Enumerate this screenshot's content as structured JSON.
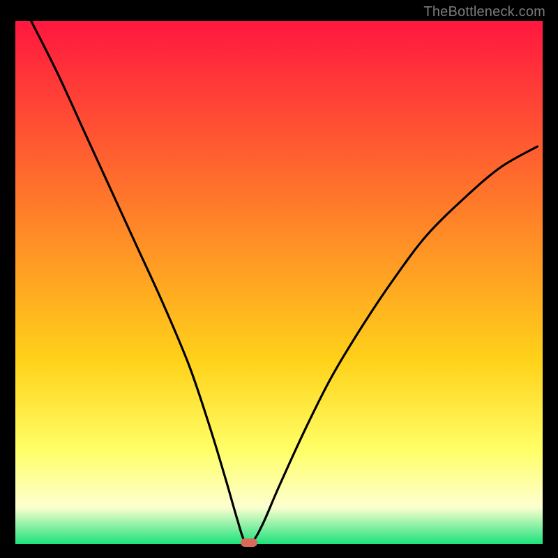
{
  "watermark": "TheBottleneck.com",
  "colors": {
    "top": "#ff173f",
    "mid1": "#ff7a2a",
    "mid2": "#ffd21a",
    "mid3": "#ffff66",
    "mid4": "#fdffd0",
    "bottom": "#1be27a",
    "curve": "#000000",
    "frame": "#000000",
    "marker": "#d96a5a"
  },
  "chart_data": {
    "type": "line",
    "title": "",
    "xlabel": "",
    "ylabel": "",
    "xlim": [
      0,
      100
    ],
    "ylim": [
      0,
      100
    ],
    "series": [
      {
        "name": "bottleneck-curve",
        "x": [
          3,
          8,
          13,
          18,
          23,
          28,
          33,
          37,
          40,
          42,
          43.5,
          45,
          47,
          50,
          55,
          60,
          66,
          72,
          78,
          85,
          92,
          99
        ],
        "values": [
          100,
          90,
          79,
          68,
          57,
          46,
          34,
          22,
          12,
          5,
          0.5,
          0.5,
          4,
          11,
          22,
          32,
          42,
          51,
          59,
          66,
          72,
          76
        ]
      }
    ],
    "marker": {
      "x": 44.3,
      "y": 0.3
    },
    "gradient_stops": [
      {
        "offset": 0,
        "value": 100,
        "color": "#ff173f"
      },
      {
        "offset": 35,
        "value": 65,
        "color": "#ff7a2a"
      },
      {
        "offset": 65,
        "value": 35,
        "color": "#ffd21a"
      },
      {
        "offset": 82,
        "value": 18,
        "color": "#ffff66"
      },
      {
        "offset": 93,
        "value": 7,
        "color": "#fdffd0"
      },
      {
        "offset": 100,
        "value": 0,
        "color": "#1be27a"
      }
    ]
  }
}
